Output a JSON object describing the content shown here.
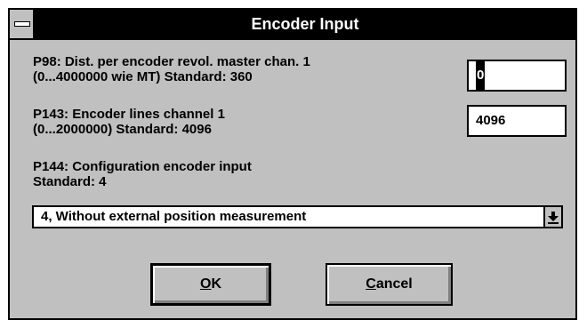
{
  "window": {
    "title": "Encoder Input"
  },
  "params": [
    {
      "line1": "P98: Dist. per encoder revol. master chan. 1",
      "line2": " (0...4000000 wie MT)  Standard: 360",
      "value": "0"
    },
    {
      "line1": "P143: Encoder lines channel 1",
      "line2": " (0...2000000)  Standard: 4096",
      "value": "4096"
    },
    {
      "line1": "P144: Configuration encoder input",
      "line2": "Standard: 4"
    }
  ],
  "config_select": {
    "selected": "4, Without external position measurement"
  },
  "buttons": {
    "ok": {
      "mnemonic": "O",
      "rest": "K"
    },
    "cancel": {
      "mnemonic": "C",
      "rest": "ancel"
    }
  }
}
